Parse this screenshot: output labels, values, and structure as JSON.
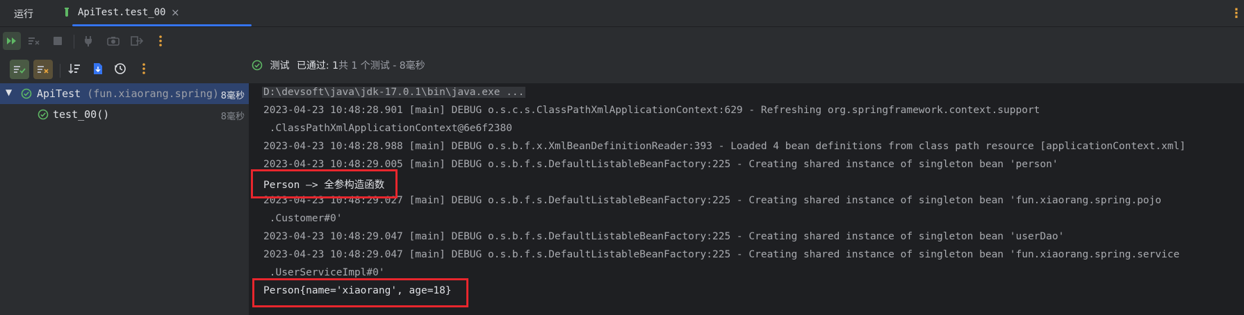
{
  "tabbar": {
    "run_label": "运行",
    "tab_title": "ApiTest.test_00",
    "close_glyph": "×"
  },
  "toolbar": {
    "buttons": [
      {
        "name": "rerun-icon",
        "enabled": true
      },
      {
        "name": "rerun-failed-icon",
        "enabled": false
      },
      {
        "name": "stop-icon",
        "enabled": false
      },
      {
        "name": "attach-debugger-icon",
        "enabled": false
      },
      {
        "name": "screenshot-icon",
        "enabled": false
      },
      {
        "name": "exit-icon",
        "enabled": false
      },
      {
        "name": "more-icon",
        "enabled": true
      }
    ]
  },
  "tree_toolbar": {
    "buttons": [
      "show-passed-icon",
      "show-ignored-icon",
      "sort-icon",
      "import-tests-icon",
      "history-icon",
      "more-icon"
    ]
  },
  "status": {
    "label_test": "测试",
    "passed_label": "已通过:",
    "passed_count": "1",
    "total_text": "共 1 个测试 - 8毫秒"
  },
  "tree": {
    "root": {
      "name": "ApiTest",
      "package": "(fun.xiaorang.spring)",
      "time": "8毫秒",
      "arrow": "▼"
    },
    "child": {
      "name": "test_00()",
      "time": "8毫秒"
    }
  },
  "console": {
    "lines": [
      {
        "text": "D:\\devsoft\\java\\jdk-17.0.1\\bin\\java.exe ...",
        "kind": "cmd"
      },
      {
        "text": "2023-04-23 10:48:28.901 [main] DEBUG o.s.c.s.ClassPathXmlApplicationContext:629 - Refreshing org.springframework.context.support",
        "kind": "log"
      },
      {
        "text": " .ClassPathXmlApplicationContext@6e6f2380",
        "kind": "log"
      },
      {
        "text": "2023-04-23 10:48:28.988 [main] DEBUG o.s.b.f.x.XmlBeanDefinitionReader:393 - Loaded 4 bean definitions from class path resource [applicationContext.xml]",
        "kind": "log"
      },
      {
        "text": "2023-04-23 10:48:29.005 [main] DEBUG o.s.b.f.s.DefaultListableBeanFactory:225 - Creating shared instance of singleton bean 'person'",
        "kind": "log"
      },
      {
        "text": "Person —> 全参构造函数",
        "kind": "out"
      },
      {
        "text": "2023-04-23 10:48:29.027 [main] DEBUG o.s.b.f.s.DefaultListableBeanFactory:225 - Creating shared instance of singleton bean 'fun.xiaorang.spring.pojo",
        "kind": "log"
      },
      {
        "text": " .Customer#0'",
        "kind": "log"
      },
      {
        "text": "2023-04-23 10:48:29.047 [main] DEBUG o.s.b.f.s.DefaultListableBeanFactory:225 - Creating shared instance of singleton bean 'userDao'",
        "kind": "log"
      },
      {
        "text": "2023-04-23 10:48:29.047 [main] DEBUG o.s.b.f.s.DefaultListableBeanFactory:225 - Creating shared instance of singleton bean 'fun.xiaorang.spring.service",
        "kind": "log"
      },
      {
        "text": " .UserServiceImpl#0'",
        "kind": "log"
      },
      {
        "text": "Person{name='xiaorang', age=18}",
        "kind": "out"
      }
    ]
  },
  "colors": {
    "accent": "#3574f0",
    "success": "#5fb865",
    "highlight_box": "#e8262d",
    "console_bg": "#1e1f22",
    "panel_bg": "#2b2d30",
    "selection": "#2e436e"
  }
}
